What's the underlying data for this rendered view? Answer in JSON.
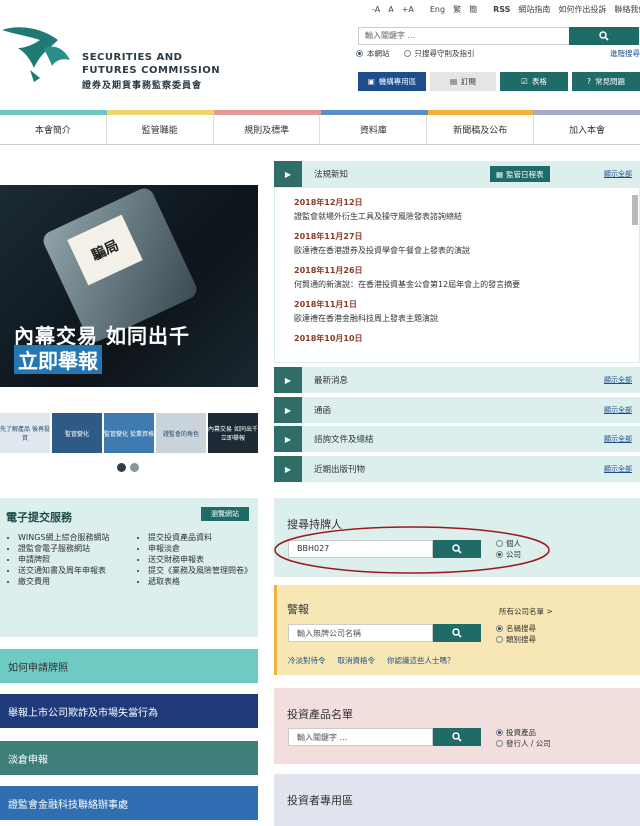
{
  "header": {
    "logo_en_1": "SECURITIES AND",
    "logo_en_2": "FUTURES COMMISSION",
    "logo_zh": "證券及期貨事務監察委員會",
    "font_small": "-A",
    "font_mid": "A",
    "font_large": "+A",
    "lang_en": "Eng",
    "lang_tc": "繁",
    "lang_sc": "簡",
    "rss": "RSS",
    "sitemap": "網站指南",
    "complaint": "如何作出投訴",
    "contact": "聯絡我們",
    "search_placeholder": "輸入關鍵字 ...",
    "scope_site": "本網站",
    "scope_code": "只搜尋守則及指引",
    "advanced": "進階搜尋",
    "btn_industry": "機構專用區",
    "btn_subscribe": "訂閱",
    "btn_forms": "表格",
    "btn_faq": "常見問題"
  },
  "nav": [
    "本會簡介",
    "監管職能",
    "規則及標準",
    "資料庫",
    "新聞稿及公布",
    "加入本會"
  ],
  "hero": {
    "line1": "內幕交易 如同出千",
    "line2": "立即舉報",
    "screen": "騙局"
  },
  "thumbs": [
    "先了解產品 後再投資",
    "監管變化",
    "監管變化 從業資格",
    "證監會的角色",
    "內幕交易 如同出千 立即舉報"
  ],
  "news": {
    "title": "法規新知",
    "calendar": "監管日程表",
    "show_all": "顯示全部",
    "items": [
      {
        "date": "2018年12月12日",
        "text": "證監會就場外衍生工具及操守風險發表諮詢總結"
      },
      {
        "date": "2018年11月27日",
        "text": "歐達禮在香港證券及投資學會午餐會上發表的演說"
      },
      {
        "date": "2018年11月26日",
        "text": "何賢通的新演說：在香港投資基金公會第12屆年會上的發言摘要"
      },
      {
        "date": "2018年11月1日",
        "text": "歐達禮在香港金融科技周上發表主題演說"
      },
      {
        "date": "2018年10月10日",
        "text": ""
      }
    ]
  },
  "panels": [
    {
      "title": "最新消息",
      "show_all": "顯示全部"
    },
    {
      "title": "通函",
      "show_all": "顯示全部"
    },
    {
      "title": "諮詢文件及總結",
      "show_all": "顯示全部"
    },
    {
      "title": "近期出版刊物",
      "show_all": "顯示全部"
    }
  ],
  "eservices": {
    "title": "電子提交服務",
    "portal": "瀏覽網站",
    "left": [
      "WINGS網上綜合服務網站",
      "證監會電子服務網站",
      "申請牌照",
      "送交通知書及周年申報表",
      "繳交費用"
    ],
    "right": [
      "提交投資產品資料",
      "申報淡倉",
      "送交財務申報表",
      "提交《業務及風險管理問卷》",
      "遞取表格"
    ]
  },
  "left_bars": [
    "如何申請牌照",
    "舉報上市公司欺詐及市場失當行為",
    "淡倉申報",
    "證監會金融科技聯絡辦事處"
  ],
  "register": {
    "title": "搜尋持牌人",
    "value": "BBH027",
    "opt_individual": "個人",
    "opt_company": "公司"
  },
  "alert": {
    "title": "警報",
    "all_list": "所有公司名單 >",
    "placeholder": "輸入無牌公司名稱",
    "opt_name": "名稱搜尋",
    "opt_type": "類別搜尋",
    "link1": "冷淡對待令",
    "link2": "取消資格令",
    "link3": "你認識這些人士嗎？"
  },
  "products": {
    "title": "投資產品名單",
    "placeholder": "輸入關鍵字 ...",
    "opt_product": "投資產品",
    "opt_issuer": "發行人 / 公司"
  },
  "investor": {
    "title": "投資者專用區"
  },
  "colors": {
    "teal": "#1f6b68",
    "light_teal": "#dcefed",
    "navy": "#1e3a7b",
    "blue": "#2577b3",
    "yellow": "#f6e7b5",
    "pink": "#f3dede",
    "lavender": "#e1e3ee"
  }
}
